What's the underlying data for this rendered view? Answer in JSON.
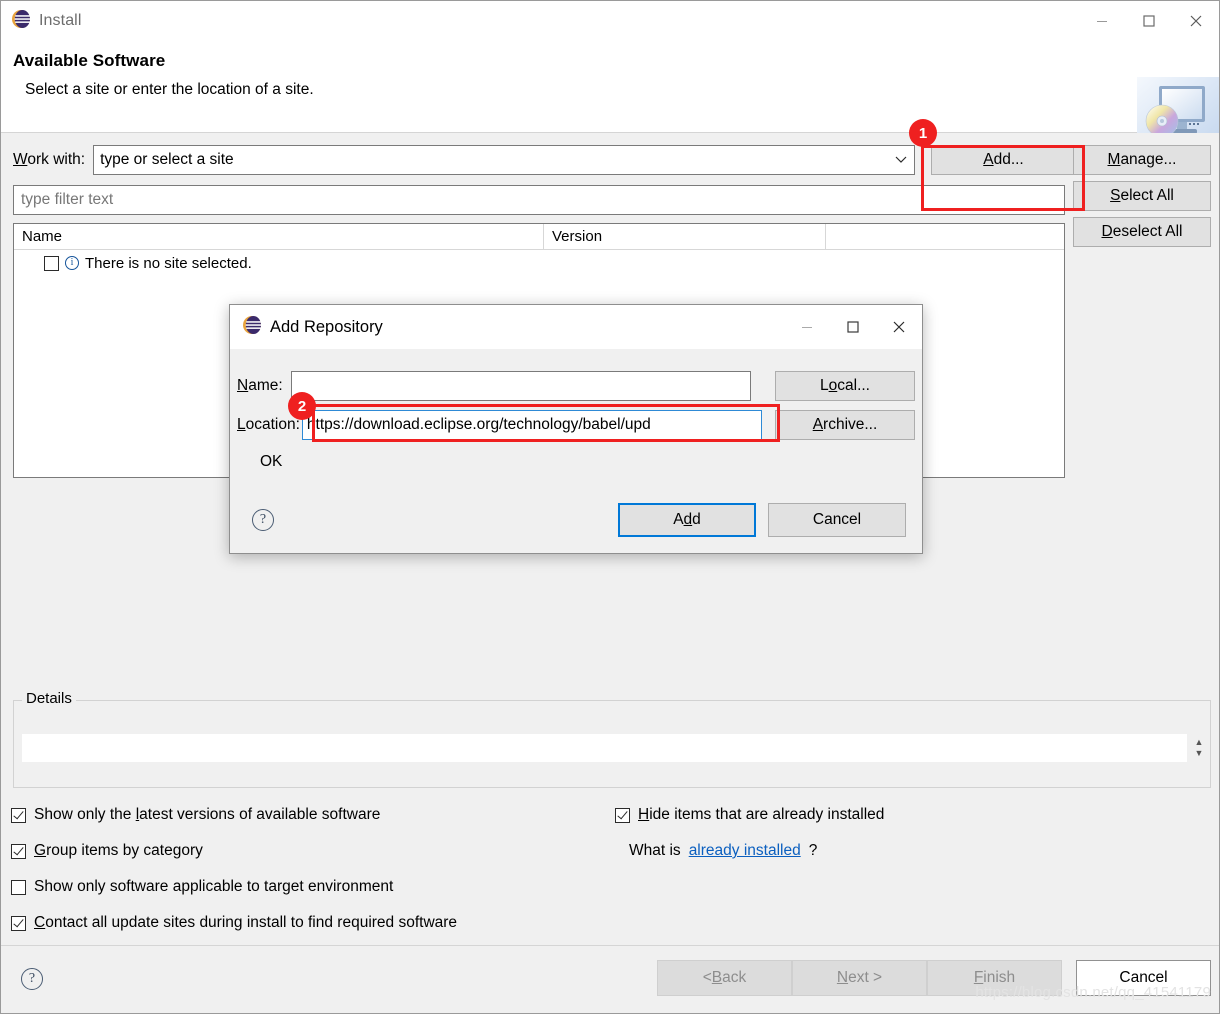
{
  "window": {
    "title": "Install",
    "app_icon": "eclipse-globe-icon",
    "controls": {
      "minimize": "—",
      "maximize": "☐",
      "close": "✕"
    }
  },
  "header": {
    "title": "Available Software",
    "subtitle": "Select a site or enter the location of a site.",
    "banner_icon": "monitor-cd-icon"
  },
  "work_with": {
    "label_prefix": "W",
    "label_rest": "ork with:",
    "value": "type or select a site",
    "chevron": "⌄"
  },
  "buttons": {
    "add": {
      "mn": "A",
      "rest": "dd..."
    },
    "manage": {
      "mn": "M",
      "rest": "anage..."
    },
    "select_all": {
      "pre": "",
      "mn": "S",
      "rest": "elect All"
    },
    "deselect_all": {
      "mn": "D",
      "rest": "eselect All"
    }
  },
  "filter": {
    "placeholder": "type filter text"
  },
  "table": {
    "columns": [
      "Name",
      "Version",
      ""
    ],
    "rows": [
      {
        "checked": false,
        "icon": "info-icon",
        "name": "There is no site selected.",
        "version": ""
      }
    ]
  },
  "details": {
    "group_label": "Details",
    "value": ""
  },
  "options": {
    "left": [
      {
        "checked": true,
        "pre": "Show only the ",
        "mn": "l",
        "post": "atest versions of available software"
      },
      {
        "checked": true,
        "pre": "",
        "mn": "G",
        "post": "roup items by category"
      },
      {
        "checked": false,
        "pre": "",
        "mn": "S",
        "post": "how only software applicable to target environment"
      },
      {
        "checked": true,
        "pre": "",
        "mn": "C",
        "post": "ontact all update sites during install to find required software"
      }
    ],
    "right": {
      "checkbox": {
        "checked": true,
        "pre": "",
        "mn": "H",
        "post": "ide items that are already installed"
      },
      "question_pre": "What is ",
      "question_link": "already installed",
      "question_post": "?"
    }
  },
  "wizard_buttons": {
    "help": "?",
    "back": {
      "pre": "< ",
      "mn": "B",
      "rest": "ack"
    },
    "next": {
      "pre": "",
      "mn": "N",
      "rest": "ext >"
    },
    "finish": {
      "pre": "",
      "mn": "F",
      "rest": "inish"
    },
    "cancel": "Cancel"
  },
  "watermark": "https://blog.csdn.net/qq_41541179",
  "modal": {
    "title": "Add Repository",
    "app_icon": "eclipse-globe-icon",
    "controls": {
      "minimize": "—",
      "maximize": "☐",
      "close": "✕"
    },
    "name_label": {
      "mn": "N",
      "rest": "ame:"
    },
    "name_value": "",
    "location_label": {
      "mn": "L",
      "rest": "ocation:"
    },
    "location_value": "https://download.eclipse.org/technology/babel/upd",
    "status_text": "OK",
    "local_button": {
      "pre": "L",
      "mn": "o",
      "rest": "cal..."
    },
    "archive_button": {
      "mn": "A",
      "rest": "rchive..."
    },
    "help": "?",
    "add_button": {
      "pre": "A",
      "mn": "d",
      "rest": "d"
    },
    "cancel_button": "Cancel"
  },
  "annotations": [
    {
      "number": "1",
      "target": "add-button"
    },
    {
      "number": "2",
      "target": "location-input"
    }
  ],
  "colors": {
    "annotation_red": "#ef2020",
    "link_blue": "#0b5fbf",
    "focus_blue": "#0078d7",
    "eclipse_purple": "#3b2a6b",
    "eclipse_orange": "#e8a33d"
  }
}
